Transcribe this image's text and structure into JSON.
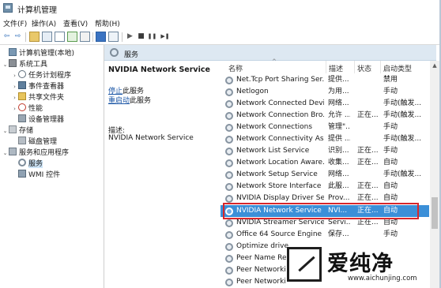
{
  "window": {
    "title": "计算机管理"
  },
  "menu": [
    {
      "label": "文件(F)"
    },
    {
      "label": "操作(A)"
    },
    {
      "label": "查看(V)"
    },
    {
      "label": "帮助(H)"
    }
  ],
  "toolbar": {
    "back_glyph": "⇦",
    "forward_glyph": "⇨",
    "play_glyph": "▶",
    "stop_glyph": "■",
    "pause_glyph": "❚❚",
    "restart_glyph": "▶❚"
  },
  "tree": [
    {
      "label": "计算机管理(本地)",
      "icon": "computer-icon"
    },
    {
      "label": "系统工具",
      "icon": "tools-icon"
    },
    {
      "label": "任务计划程序",
      "icon": "clock-icon"
    },
    {
      "label": "事件查看器",
      "icon": "event-viewer-icon"
    },
    {
      "label": "共享文件夹",
      "icon": "folder-icon"
    },
    {
      "label": "性能",
      "icon": "performance-icon"
    },
    {
      "label": "设备管理器",
      "icon": "device-manager-icon"
    },
    {
      "label": "存储",
      "icon": "storage-icon"
    },
    {
      "label": "磁盘管理",
      "icon": "disk-icon"
    },
    {
      "label": "服务和应用程序",
      "icon": "services-apps-icon"
    },
    {
      "label": "服务",
      "icon": "gear-icon"
    },
    {
      "label": "WMI 控件",
      "icon": "wmi-icon"
    }
  ],
  "pane": {
    "header": "服务",
    "selected_title": "NVIDIA Network Service",
    "stop_link": "停止",
    "stop_suffix": "此服务",
    "restart_link": "重启动",
    "restart_suffix": "此服务",
    "desc_label": "描述:",
    "desc_text": "NVIDIA Network Service"
  },
  "columns": {
    "name": "名称",
    "desc": "描述",
    "status": "状态",
    "start": "启动类型"
  },
  "services": [
    {
      "name": "Net.Tcp Port Sharing Ser...",
      "desc": "提供...",
      "status": "",
      "start": "禁用"
    },
    {
      "name": "Netlogon",
      "desc": "为用...",
      "status": "",
      "start": "手动"
    },
    {
      "name": "Network Connected Devi...",
      "desc": "网络...",
      "status": "",
      "start": "手动(触发..."
    },
    {
      "name": "Network Connection Bro...",
      "desc": "允许 ...",
      "status": "正在...",
      "start": "手动(触发..."
    },
    {
      "name": "Network Connections",
      "desc": "管理\"...",
      "status": "",
      "start": "手动"
    },
    {
      "name": "Network Connectivity Ass...",
      "desc": "提供 ...",
      "status": "",
      "start": "手动(触发..."
    },
    {
      "name": "Network List Service",
      "desc": "识别...",
      "status": "正在...",
      "start": "手动"
    },
    {
      "name": "Network Location Aware...",
      "desc": "收集...",
      "status": "正在...",
      "start": "自动"
    },
    {
      "name": "Network Setup Service",
      "desc": "网络...",
      "status": "",
      "start": "手动(触发..."
    },
    {
      "name": "Network Store Interface ...",
      "desc": "此服...",
      "status": "正在...",
      "start": "自动"
    },
    {
      "name": "NVIDIA Display Driver Se...",
      "desc": "Prov...",
      "status": "正在...",
      "start": "自动"
    },
    {
      "name": "NVIDIA Network Service",
      "desc": "NVI...",
      "status": "正在...",
      "start": "自动"
    },
    {
      "name": "NVIDIA Streamer Service",
      "desc": "Servi...",
      "status": "正在...",
      "start": "自动"
    },
    {
      "name": "Office 64 Source Engine",
      "desc": "保存...",
      "status": "",
      "start": "手动"
    },
    {
      "name": "Optimize drive",
      "desc": "",
      "status": "",
      "start": ""
    },
    {
      "name": "Peer Name Re",
      "desc": "",
      "status": "",
      "start": ""
    },
    {
      "name": "Peer Networki",
      "desc": "",
      "status": "",
      "start": ""
    },
    {
      "name": "Peer Networki",
      "desc": "",
      "status": "",
      "start": ""
    }
  ],
  "watermark": {
    "text": "爱纯净",
    "url": "www.aichunjing.com"
  },
  "colors": {
    "selection": "#3b8fd8",
    "highlight_box": "#d8262b",
    "link": "#1a55a5",
    "header_strip": "#dde8f2"
  }
}
